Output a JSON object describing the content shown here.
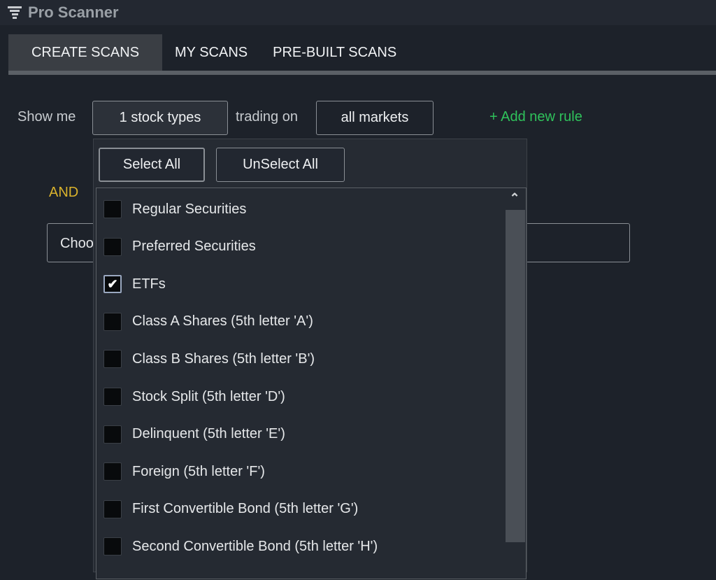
{
  "app": {
    "title": "Pro Scanner",
    "icon": "filter-icon"
  },
  "tabs": [
    {
      "label": "CREATE SCANS",
      "active": true
    },
    {
      "label": "MY SCANS"
    },
    {
      "label": "PRE-BUILT SCANS"
    }
  ],
  "rule": {
    "show_me": "Show me",
    "stock_types": "1 stock types",
    "trading_on": "trading on",
    "markets": "all markets",
    "add_rule": "+ Add new rule",
    "and": "AND",
    "choose": "Choo"
  },
  "dropdown": {
    "select_all": "Select All",
    "unselect_all": "UnSelect All",
    "items": [
      {
        "label": "Regular Securities",
        "checked": false
      },
      {
        "label": "Preferred Securities",
        "checked": false
      },
      {
        "label": "ETFs",
        "checked": true
      },
      {
        "label": "Class A Shares (5th letter 'A')",
        "checked": false
      },
      {
        "label": "Class B Shares (5th letter 'B')",
        "checked": false
      },
      {
        "label": "Stock Split (5th letter 'D')",
        "checked": false
      },
      {
        "label": "Delinquent (5th letter 'E')",
        "checked": false
      },
      {
        "label": "Foreign (5th letter 'F')",
        "checked": false
      },
      {
        "label": "First Convertible Bond (5th letter 'G')",
        "checked": false
      },
      {
        "label": "Second Convertible Bond (5th letter 'H')",
        "checked": false
      }
    ]
  },
  "colors": {
    "accent_green": "#2fc25b",
    "and_yellow": "#d9b22c"
  }
}
